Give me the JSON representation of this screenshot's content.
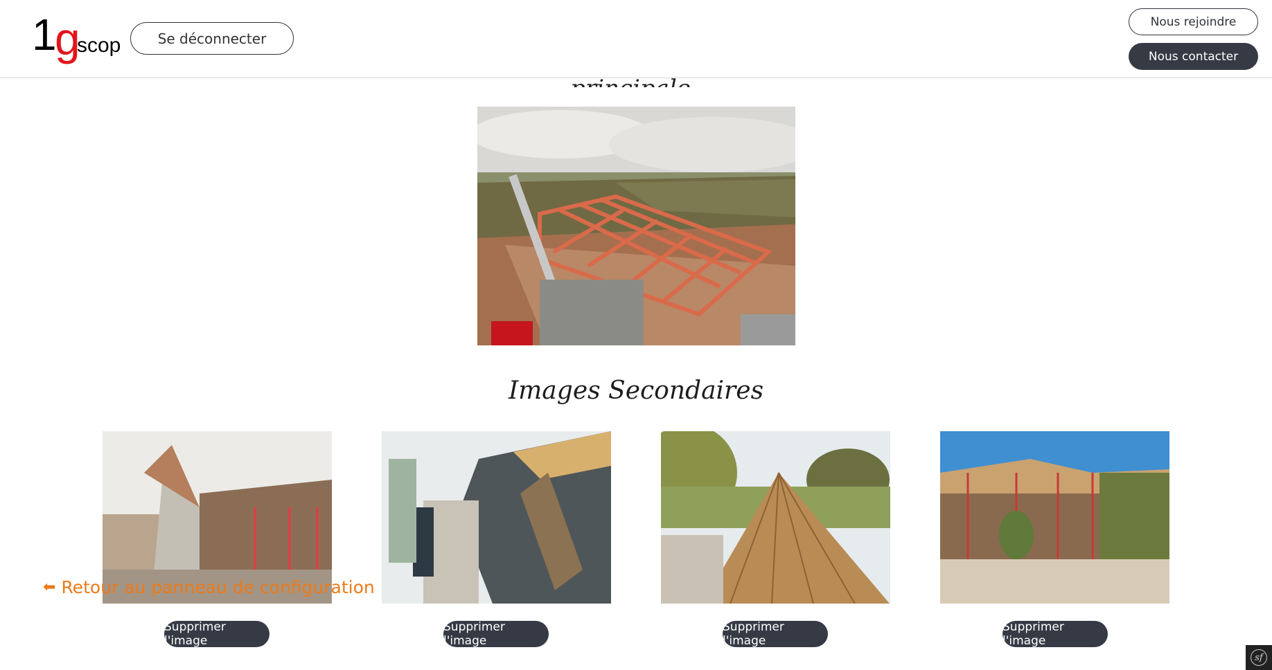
{
  "header": {
    "logo": {
      "one": "1",
      "g": "g",
      "scop": "scop"
    },
    "logout_label": "Se déconnecter",
    "join_label": "Nous rejoindre",
    "contact_label": "Nous contacter"
  },
  "main": {
    "cut_title": "Image principale",
    "main_image_icon": "photo-roof-framing",
    "secondary_title": "Images Secondaires",
    "secondary_images": [
      {
        "icon": "photo-stone-gable",
        "delete_label": "Supprimer l'image"
      },
      {
        "icon": "photo-slate-roof",
        "delete_label": "Supprimer l'image"
      },
      {
        "icon": "photo-roof-battens",
        "delete_label": "Supprimer l'image"
      },
      {
        "icon": "photo-house-scaffolding",
        "delete_label": "Supprimer l'image"
      }
    ],
    "back_link": "Retour au panneau de configuration"
  },
  "colors": {
    "dark": "#353a45",
    "logo_red": "#e3141b",
    "link_orange": "#ec7a1a"
  }
}
